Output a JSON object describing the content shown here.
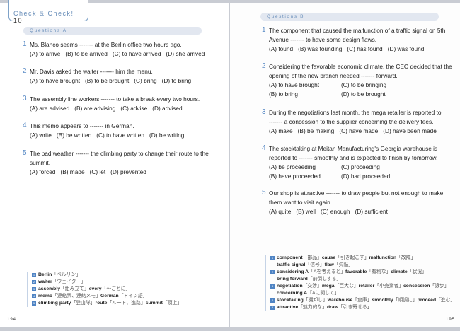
{
  "header": {
    "title": "Check & Check!",
    "number": "10"
  },
  "left": {
    "section": "Questions A",
    "page_number": "194",
    "questions": [
      {
        "n": "1",
        "lines": [
          "Ms. Blanco seems ------- at the Berlin office two hours ago."
        ],
        "options": [
          [
            "(A) to arrive",
            "(B) to be arrived",
            "(C) to have arrived",
            "(D) she arrived"
          ]
        ]
      },
      {
        "n": "2",
        "lines": [
          "Mr. Davis asked the waiter ------- him the menu."
        ],
        "options": [
          [
            "(A) to have brought",
            "(B) to be brought",
            "(C) bring",
            "(D) to bring"
          ]
        ]
      },
      {
        "n": "3",
        "lines": [
          "The assembly line workers ------- to take a break every two hours."
        ],
        "options": [
          [
            "(A) are advised",
            "(B) are advising",
            "(C) advise",
            "(D) advised"
          ]
        ]
      },
      {
        "n": "4",
        "lines": [
          "This memo appears to ------- in German."
        ],
        "options": [
          [
            "(A) write",
            "(B) be written",
            "(C) to have written",
            "(D) be writing"
          ]
        ]
      },
      {
        "n": "5",
        "lines": [
          "The bad weather ------- the climbing party to change their route to the",
          "summit."
        ],
        "options": [
          [
            "(A) forced",
            "(B) made",
            "(C) let",
            "(D) prevented"
          ]
        ]
      }
    ],
    "vocab": [
      {
        "n": "1",
        "items": [
          [
            "Berlin",
            "「ベルリン」"
          ]
        ]
      },
      {
        "n": "2",
        "items": [
          [
            "waiter",
            "「ウェイター」"
          ]
        ]
      },
      {
        "n": "3",
        "items": [
          [
            "assembly",
            "「組み立て」"
          ],
          [
            "every",
            "「～ごとに」"
          ]
        ]
      },
      {
        "n": "4",
        "items": [
          [
            "memo",
            "「連絡票、連絡メモ」"
          ],
          [
            "German",
            "「ドイツ語」"
          ]
        ]
      },
      {
        "n": "5",
        "items": [
          [
            "climbing party",
            "「登山隊」"
          ],
          [
            "route",
            "「ルート、進路」"
          ],
          [
            "summit",
            "「頂上」"
          ]
        ]
      }
    ]
  },
  "right": {
    "section": "Questions B",
    "page_number": "195",
    "questions": [
      {
        "n": "1",
        "lines": [
          "The component that caused the malfunction of a traffic signal on 5th",
          "Avenue ------- to have some design flaws."
        ],
        "options": [
          [
            "(A) found",
            "(B) was founding",
            "(C) has found",
            "(D) was found"
          ]
        ]
      },
      {
        "n": "2",
        "lines": [
          "Considering the favorable economic climate, the CEO decided that the",
          "opening of the new branch needed ------- forward."
        ],
        "options": [
          [
            "(A) to have brought",
            "(C) to be bringing"
          ],
          [
            "(B) to bring",
            "(D) to be brought"
          ]
        ]
      },
      {
        "n": "3",
        "lines": [
          "During the negotiations last month, the mega retailer is reported to",
          "------- a concession to the supplier concerning the delivery fees."
        ],
        "options": [
          [
            "(A) make",
            "(B) be making",
            "(C) have made",
            "(D) have been made"
          ]
        ]
      },
      {
        "n": "4",
        "lines": [
          "The stocktaking at Meitan Manufacturing's Georgia warehouse is",
          "reported to ------- smoothly and is expected to finish by tomorrow."
        ],
        "options": [
          [
            "(A) be proceeding",
            "(C) proceeding"
          ],
          [
            "(B) have proceeded",
            "(D) had proceeded"
          ]
        ]
      },
      {
        "n": "5",
        "lines": [
          "Our shop is attractive ------- to draw people but not enough to make",
          "them want to visit again."
        ],
        "options": [
          [
            "(A) quite",
            "(B) well",
            "(C) enough",
            "(D) sufficient"
          ]
        ]
      }
    ],
    "vocab": [
      {
        "n": "1",
        "items": [
          [
            "component",
            "「部品」"
          ],
          [
            "cause",
            "「引き起こす」"
          ],
          [
            "malfunction",
            "「故障」"
          ]
        ],
        "cont": [
          [
            "traffic signal",
            "「信号」"
          ],
          [
            "flaw",
            "「欠陥」"
          ]
        ]
      },
      {
        "n": "2",
        "items": [
          [
            "considering A",
            "「Aを考えると」"
          ],
          [
            "favorable",
            "「有利な」"
          ],
          [
            "climate",
            "「状況」"
          ]
        ],
        "cont": [
          [
            "bring forward",
            "「前倒しする」"
          ]
        ]
      },
      {
        "n": "3",
        "items": [
          [
            "negotiation",
            "「交渉」"
          ],
          [
            "mega",
            "「巨大な」"
          ],
          [
            "retailer",
            "「小売業者」"
          ],
          [
            "concession",
            "「譲歩」"
          ]
        ],
        "cont": [
          [
            "concerning A",
            "「Aに関して」"
          ]
        ]
      },
      {
        "n": "4",
        "items": [
          [
            "stocktaking",
            "「棚卸し」"
          ],
          [
            "warehouse",
            "「倉庫」"
          ],
          [
            "smoothly",
            "「順調に」"
          ],
          [
            "proceed",
            "「進む」"
          ]
        ]
      },
      {
        "n": "5",
        "items": [
          [
            "attractive",
            "「魅力的な」"
          ],
          [
            "draw",
            "「引き寄せる」"
          ]
        ]
      }
    ]
  }
}
